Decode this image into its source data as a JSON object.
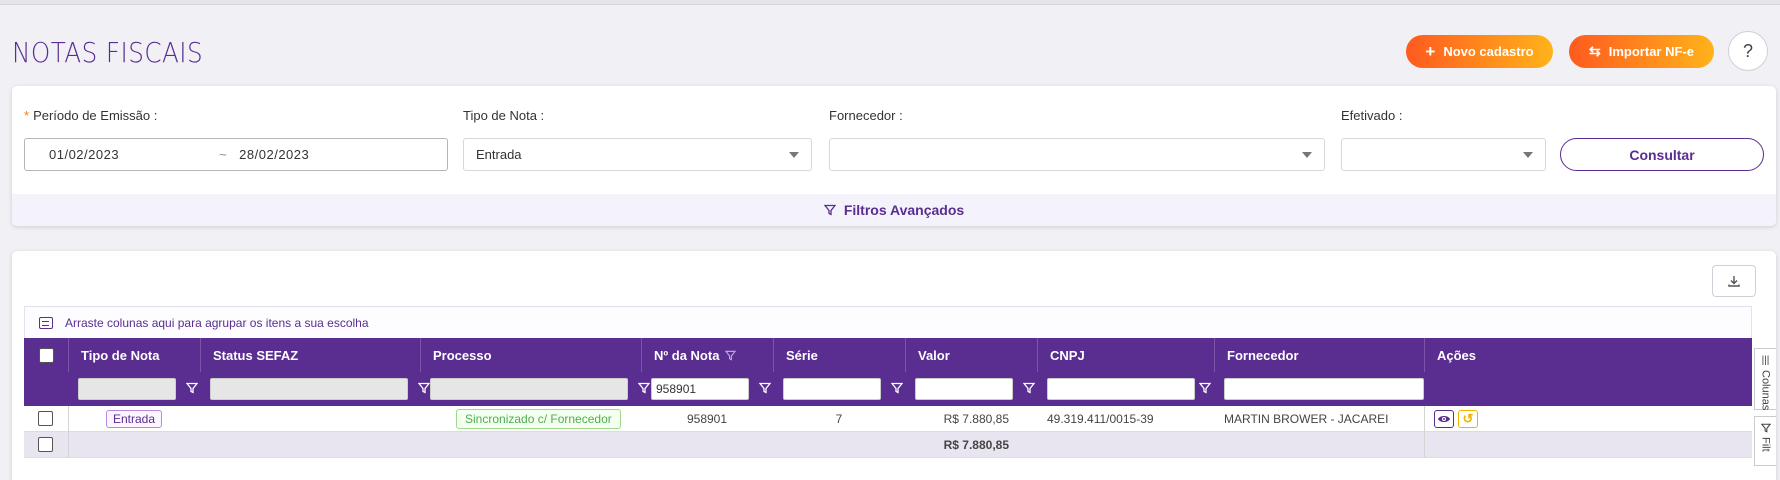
{
  "page": {
    "title": "NOTAS FISCAIS",
    "novo_label": "Novo cadastro",
    "importar_label": "Importar NF-e",
    "help_label": "?"
  },
  "filters": {
    "periodo_label": "Período de Emissão :",
    "date_start": "01/02/2023",
    "date_sep": "~",
    "date_end": "28/02/2023",
    "tipo_label": "Tipo de Nota :",
    "tipo_value": "Entrada",
    "fornecedor_label": "Fornecedor :",
    "fornecedor_value": "",
    "efetivado_label": "Efetivado :",
    "efetivado_value": "",
    "consultar_label": "Consultar",
    "avancados_label": "Filtros Avançados"
  },
  "grid": {
    "group_hint": "Arraste colunas aqui para agrupar os itens a sua escolha",
    "columns": [
      "Tipo de Nota",
      "Status SEFAZ",
      "Processo",
      "Nº da Nota",
      "Série",
      "Valor",
      "CNPJ",
      "Fornecedor",
      "Ações"
    ],
    "filter_nota": "958901",
    "rows": [
      {
        "tipo": "Entrada",
        "status": "",
        "processo": "Sincronizado c/ Fornecedor",
        "nota": "958901",
        "serie": "7",
        "valor": "R$ 7.880,85",
        "cnpj": "49.319.411/0015-39",
        "fornecedor": "MARTIN BROWER - JACAREI"
      }
    ],
    "total_valor": "R$ 7.880,85",
    "side_colunas": "Colunas",
    "side_filtros": "Filt"
  },
  "colors": {
    "primary": "#5a2d91",
    "orange_start": "#ff5a1f",
    "orange_end": "#ffb31a"
  }
}
